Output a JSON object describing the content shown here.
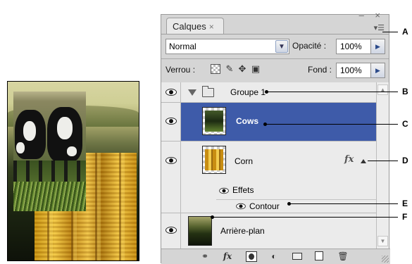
{
  "panel": {
    "tab_label": "Calques",
    "tab_close": "×",
    "window_controls": "– ×",
    "menu_icon": "panel-menu-icon",
    "blend_mode": "Normal",
    "opacity_label": "Opacité :",
    "opacity_value": "100%",
    "lock_label": "Verrou :",
    "fill_label": "Fond :",
    "fill_value": "100%",
    "layers": [
      {
        "name": "Groupe 1",
        "type": "group",
        "visible": true,
        "expanded": true
      },
      {
        "name": "Cows",
        "type": "layer",
        "visible": true,
        "selected": true
      },
      {
        "name": "Corn",
        "type": "layer",
        "visible": true,
        "has_effects": true
      },
      {
        "name": "Effets",
        "type": "effects-header",
        "visible": true
      },
      {
        "name": "Contour",
        "type": "effect",
        "visible": true
      },
      {
        "name": "Arrière-plan",
        "type": "background",
        "visible": true
      }
    ],
    "fx_symbol": "fx",
    "bottom_icons": [
      "link-icon",
      "fx-icon",
      "mask-icon",
      "adjustment-icon",
      "folder-icon",
      "new-layer-icon",
      "trash-icon"
    ]
  },
  "callouts": [
    "A",
    "B",
    "C",
    "D",
    "E",
    "F"
  ],
  "colors": {
    "selection": "#3e5ba9",
    "panel_bg": "#d5d5d5",
    "list_bg": "#ebebeb"
  }
}
